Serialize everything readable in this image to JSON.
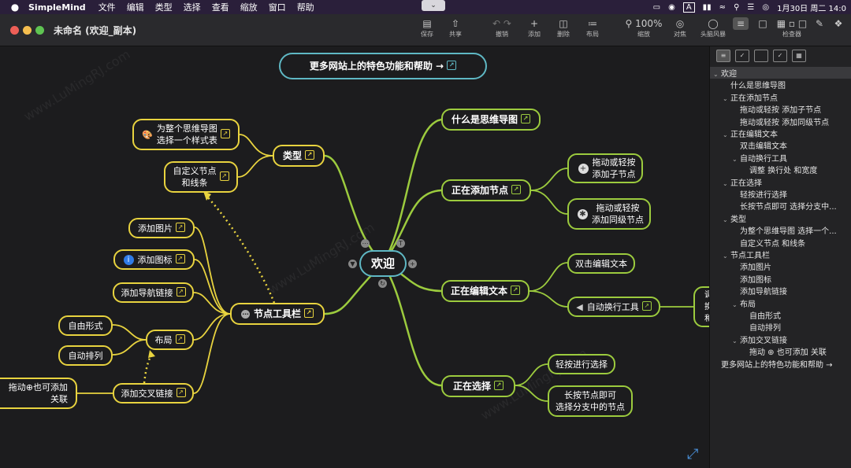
{
  "menubar": {
    "apple": "",
    "app_name": "SimpleMind",
    "items": [
      "文件",
      "编辑",
      "类型",
      "选择",
      "查看",
      "缩放",
      "窗口",
      "帮助"
    ],
    "input_badge": "A",
    "datetime": "1月30日 周二  14:0"
  },
  "window": {
    "title": "未命名 (欢迎_副本)",
    "zoom": "100%"
  },
  "toolbar": {
    "save": "保存",
    "share": "共享",
    "undo": "撤销",
    "add": "添加",
    "delete": "删除",
    "layout": "布局",
    "zoom": "缩放",
    "focus": "对焦",
    "brainstorm": "头脑风暴",
    "inspector": "检查器"
  },
  "colors": {
    "main": "#5fb8c4",
    "green": "#9ccb3e",
    "yellow": "#e8d33f",
    "bg": "#1c1c1e"
  },
  "mindmap": {
    "top_link": "更多网站上的特色功能和帮助 →",
    "center": "欢迎",
    "what": "什么是思维导图",
    "adding": "正在添加节点",
    "add_child_1": "拖动或轻按",
    "add_child_2": "添加子节点",
    "add_sibling_1": "拖动或轻按",
    "add_sibling_2": "添加同级节点",
    "editing": "正在编辑文本",
    "dbl_edit": "双击编辑文本",
    "auto_wrap": "自动换行工具",
    "partial_1": "调",
    "partial_2": "换",
    "partial_3": "和",
    "selecting": "正在选择",
    "tap_select": "轻按进行选择",
    "long_1": "长按节点即可",
    "long_2": "选择分支中的节点",
    "type": "类型",
    "style_1": "为整个思维导图",
    "style_2": "选择一个样式表",
    "custom_1": "自定义节点",
    "custom_2": "和线条",
    "toolbar_node": "节点工具栏",
    "add_image": "添加图片",
    "add_icon": "添加图标",
    "add_nav": "添加导航链接",
    "layout": "布局",
    "free": "自由形式",
    "auto": "自动排列",
    "cross": "添加交叉链接",
    "drag_1": "拖动⊕也可添加",
    "drag_2": "关联"
  },
  "outline": [
    {
      "text": "欢迎",
      "level": 0,
      "toggle": "v"
    },
    {
      "text": "什么是思维导图",
      "level": 1,
      "toggle": ""
    },
    {
      "text": "正在添加节点",
      "level": 1,
      "toggle": "v"
    },
    {
      "text": "拖动或轻按 添加子节点",
      "level": 2,
      "toggle": ""
    },
    {
      "text": "拖动或轻按 添加同级节点",
      "level": 2,
      "toggle": ""
    },
    {
      "text": "正在编辑文本",
      "level": 1,
      "toggle": "v"
    },
    {
      "text": "双击编辑文本",
      "level": 2,
      "toggle": ""
    },
    {
      "text": "自动换行工具",
      "level": 2,
      "toggle": "v"
    },
    {
      "text": "调整 换行处 和宽度",
      "level": 3,
      "toggle": ""
    },
    {
      "text": "正在选择",
      "level": 1,
      "toggle": "v"
    },
    {
      "text": "轻按进行选择",
      "level": 2,
      "toggle": ""
    },
    {
      "text": "长按节点即可 选择分支中...",
      "level": 2,
      "toggle": ""
    },
    {
      "text": "类型",
      "level": 1,
      "toggle": "v"
    },
    {
      "text": "为整个思维导图 选择一个...",
      "level": 2,
      "toggle": ""
    },
    {
      "text": "自定义节点 和线条",
      "level": 2,
      "toggle": ""
    },
    {
      "text": "节点工具栏",
      "level": 1,
      "toggle": "v"
    },
    {
      "text": "添加图片",
      "level": 2,
      "toggle": ""
    },
    {
      "text": "添加图标",
      "level": 2,
      "toggle": ""
    },
    {
      "text": "添加导航链接",
      "level": 2,
      "toggle": ""
    },
    {
      "text": "布局",
      "level": 2,
      "toggle": "v"
    },
    {
      "text": "自由形式",
      "level": 3,
      "toggle": ""
    },
    {
      "text": "自动排列",
      "level": 3,
      "toggle": ""
    },
    {
      "text": "添加交叉链接",
      "level": 2,
      "toggle": "v"
    },
    {
      "text": "拖动 ⊕ 也可添加 关联",
      "level": 3,
      "toggle": ""
    },
    {
      "text": "更多网站上的特色功能和帮助 →",
      "level": 0,
      "toggle": ""
    }
  ]
}
